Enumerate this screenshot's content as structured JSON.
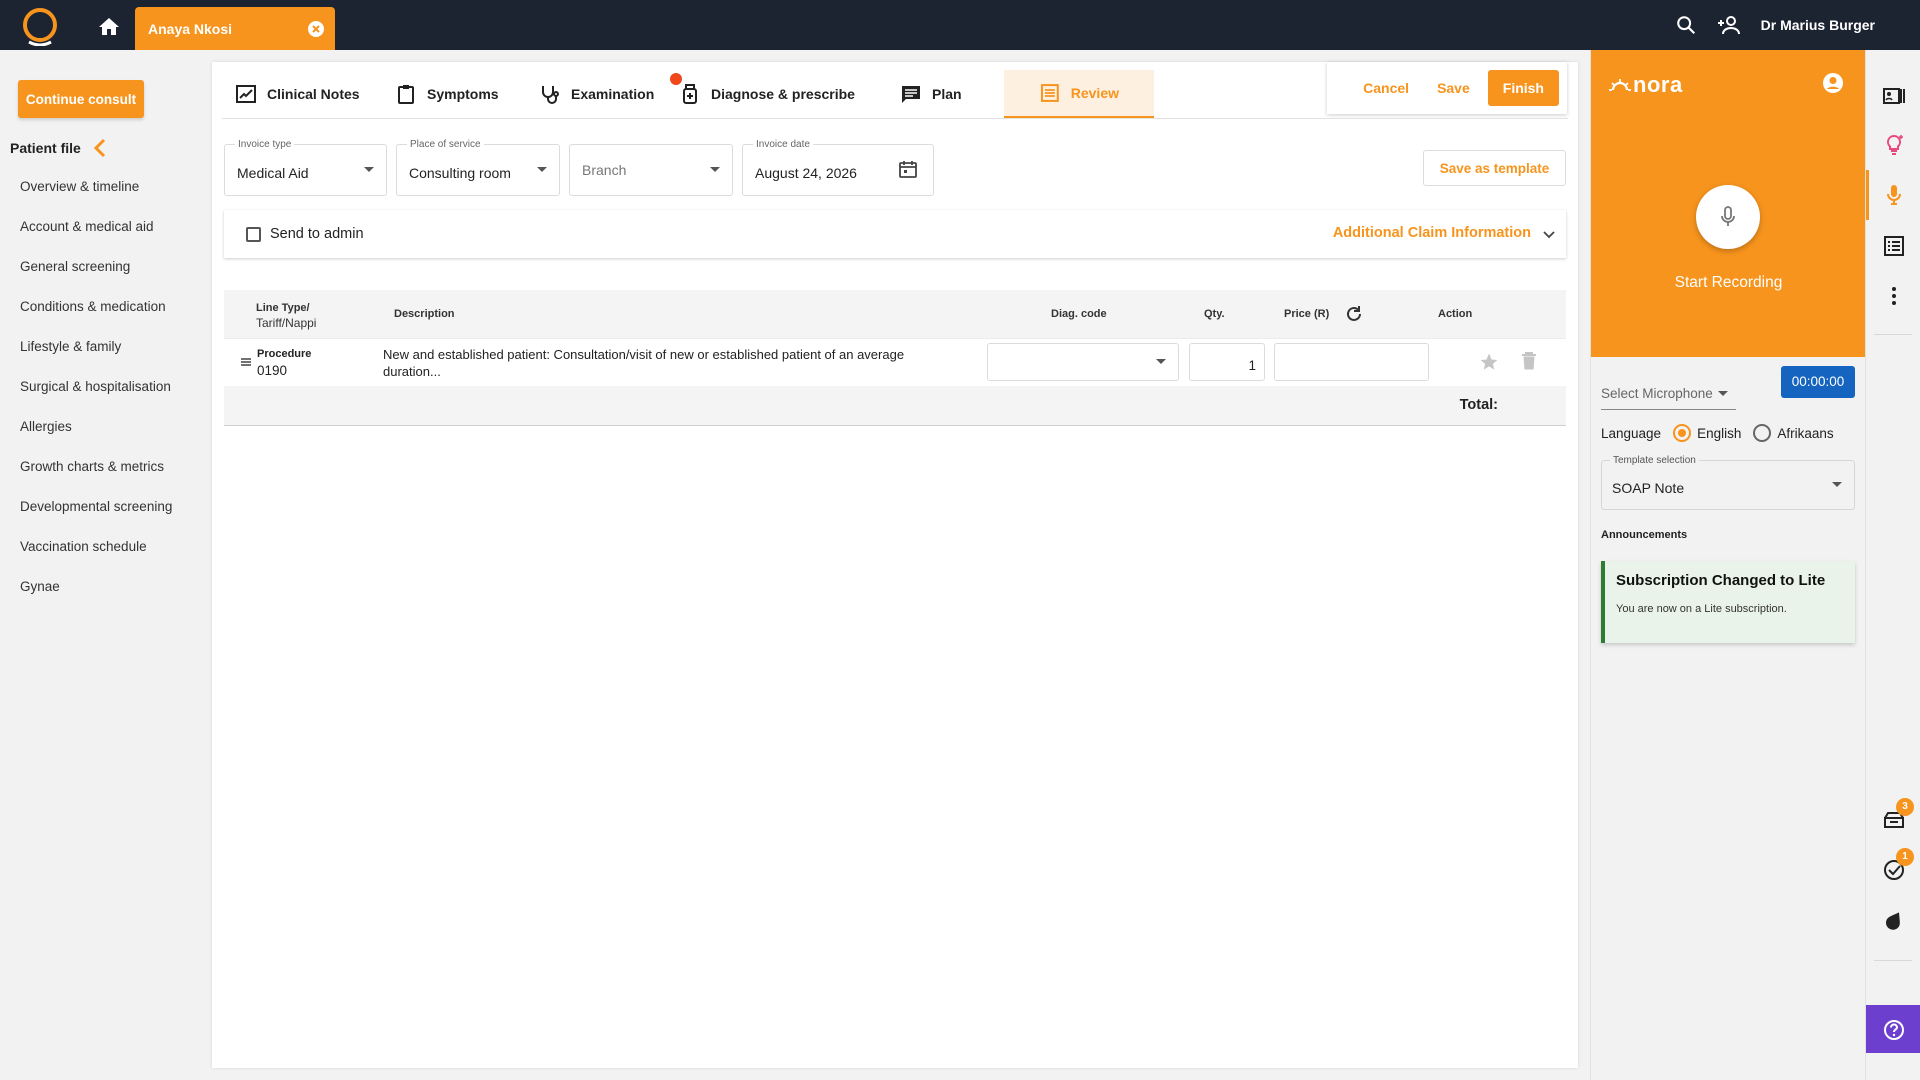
{
  "topbar": {
    "patient_name": "Anaya Nkosi",
    "doctor_name": "Dr Marius Burger"
  },
  "sidebar": {
    "continue_label": "Continue consult",
    "patient_file_label": "Patient file",
    "items": [
      {
        "label": "Overview & timeline"
      },
      {
        "label": "Account & medical aid"
      },
      {
        "label": "General screening"
      },
      {
        "label": "Conditions & medication"
      },
      {
        "label": "Lifestyle & family"
      },
      {
        "label": "Surgical & hospitalisation"
      },
      {
        "label": "Allergies"
      },
      {
        "label": "Growth charts & metrics"
      },
      {
        "label": "Developmental screening"
      },
      {
        "label": "Vaccination schedule"
      },
      {
        "label": "Gynae"
      }
    ]
  },
  "tabs": {
    "clinical_notes": "Clinical Notes",
    "symptoms": "Symptoms",
    "examination": "Examination",
    "diagnose": "Diagnose & prescribe",
    "plan": "Plan",
    "review": "Review"
  },
  "actions": {
    "cancel": "Cancel",
    "save": "Save",
    "finish": "Finish"
  },
  "invoice": {
    "type_label": "Invoice type",
    "type_value": "Medical Aid",
    "place_label": "Place of service",
    "place_value": "Consulting room",
    "branch_placeholder": "Branch",
    "date_label": "Invoice date",
    "date_value": "August 24, 2026",
    "save_template": "Save as template",
    "send_to_admin": "Send to admin",
    "additional_claim": "Additional Claim Information"
  },
  "table": {
    "headers": {
      "line_type": "Line Type/",
      "line_type_sub": "Tariff/Nappi",
      "description": "Description",
      "diag_code": "Diag. code",
      "qty": "Qty.",
      "price": "Price (R)",
      "action": "Action"
    },
    "rows": [
      {
        "type": "Procedure",
        "code": "0190",
        "description_line1": "New and established patient: Consultation/visit of new or established patient of an average",
        "description_line2": "duration...",
        "qty": "1"
      }
    ],
    "total_label": "Total:"
  },
  "nora": {
    "brand": "nora",
    "start_recording": "Start Recording",
    "select_microphone": "Select Microphone",
    "timer": "00:00:00",
    "language_label": "Language",
    "lang_english": "English",
    "lang_afrikaans": "Afrikaans",
    "template_label": "Template selection",
    "template_value": "SOAP Note",
    "announcements_label": "Announcements",
    "announcement_title": "Subscription Changed to Lite",
    "announcement_body": "You are now on a Lite subscription."
  },
  "rail": {
    "badge_inbox": "3",
    "badge_tasks": "1"
  },
  "colors": {
    "accent": "#f7941d",
    "topbar": "#1c2331",
    "timer": "#1565c0",
    "help": "#6c3fcf",
    "announcement_border": "#2e7d32",
    "notification_dot": "#f0471b"
  }
}
